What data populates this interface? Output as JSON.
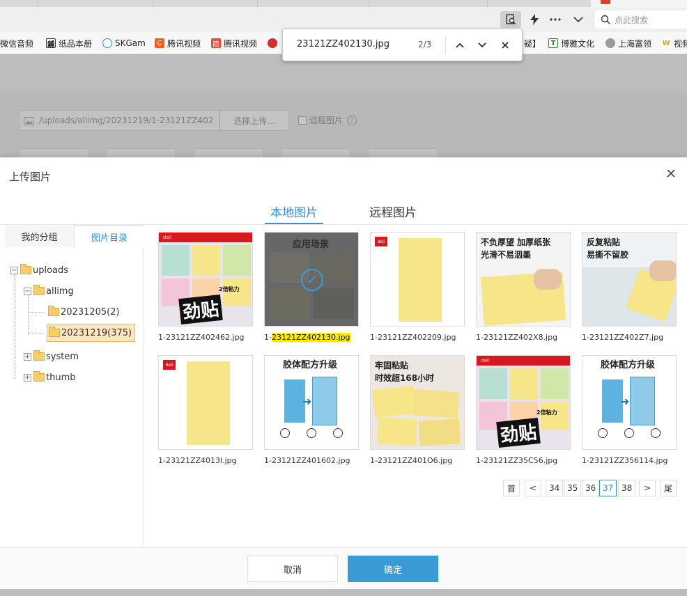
{
  "browser": {
    "search_placeholder": "点此搜索",
    "bookmarks": [
      {
        "label": "微信音频",
        "icon": "wechat-icon",
        "color": "#2aae67"
      },
      {
        "label": "纸品本册",
        "icon": "store-icon",
        "color": "#333333"
      },
      {
        "label": "SKGam",
        "icon": "globe-icon",
        "color": "#2b8ed6"
      },
      {
        "label": "腾讯视频",
        "icon": "c-logo-icon",
        "color": "#ff5a1f"
      },
      {
        "label": "腾讯视频",
        "icon": "jian-icon",
        "color": "#e84a3c"
      },
      {
        "label": "",
        "icon": "lips-icon",
        "color": "#d42e2e"
      },
      {
        "label": "疑】",
        "icon": "",
        "color": ""
      },
      {
        "label": "博雅文化",
        "icon": "t-icon",
        "color": "#3b7a2c"
      },
      {
        "label": "上海富领",
        "icon": "globe-icon",
        "color": "#777777"
      },
      {
        "label": "视频",
        "icon": "w-icon",
        "color": "#e8a020"
      }
    ]
  },
  "findbar": {
    "query": "23121ZZ402130.jpg",
    "count": "2/3"
  },
  "background_page": {
    "path_value": "/uploads/allimg/20231219/1-23121ZZ402",
    "select_button": "选择上传...",
    "remote_label": "远程图片"
  },
  "modal": {
    "title": "上传图片",
    "tabs": [
      "本地图片",
      "远程图片"
    ],
    "side_tabs": [
      "我的分组",
      "图片目录"
    ],
    "tree": {
      "root": "uploads",
      "allimg": "allimg",
      "d1": "20231205(2)",
      "d2": "20231219(375)",
      "system": "system",
      "thumb": "thumb"
    },
    "images": [
      {
        "name": "1-23121ZZ402462.jpg"
      },
      {
        "name_prefix": "1-",
        "name_highlight": "23121ZZ402130.jpg",
        "caption": "应用场景"
      },
      {
        "name": "1-23121ZZ402209.jpg"
      },
      {
        "name": "1-23121ZZ402X8.jpg",
        "caption1": "不负厚望 加厚纸张",
        "caption2": "光滑不易洇墨"
      },
      {
        "name": "1-23121ZZ402Z7.jpg",
        "caption1": "反复粘贴",
        "caption2": "易撕不留胶"
      },
      {
        "name": "1-23121ZZ4013l.jpg"
      },
      {
        "name": "1-23121ZZ401602.jpg",
        "caption": "胶体配方升级"
      },
      {
        "name": "1-23121ZZ401O6.jpg",
        "caption1": "牢固粘贴",
        "caption2": "时效超168小时"
      },
      {
        "name": "1-23121ZZ35C56.jpg"
      },
      {
        "name": "1-23121ZZ356114.jpg",
        "caption": "胶体配方升级"
      }
    ],
    "thumb_texts": {
      "brand": "deli",
      "jintie": "劲贴",
      "sub": "2倍粘力"
    },
    "pager": {
      "first": "首",
      "prev": "<",
      "pages": [
        "34",
        "35",
        "36",
        "37",
        "38"
      ],
      "current": "37",
      "next": ">",
      "last": "尾"
    },
    "cancel": "取消",
    "ok": "确定"
  },
  "colors": {
    "accent": "#3a8fd0",
    "ok_button": "#3a9ad4",
    "highlight": "#ffeb00",
    "note_yellow": "#f7e58a"
  }
}
